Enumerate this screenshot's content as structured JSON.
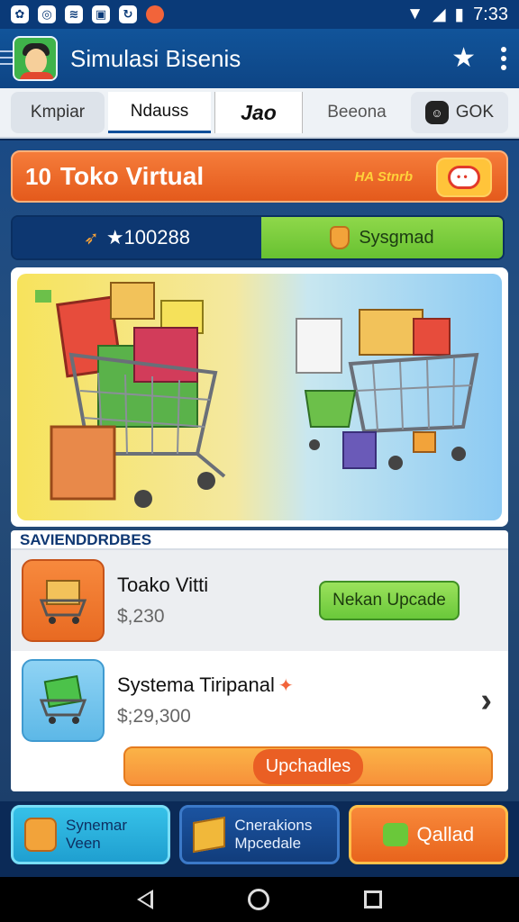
{
  "status_bar": {
    "icons": [
      "app-notification-icon",
      "messenger-icon",
      "notes-icon",
      "image-icon",
      "refresh-icon",
      "tomato-icon"
    ],
    "time": "7:33"
  },
  "app_bar": {
    "title": "Simulasi Bisenis"
  },
  "tabs": [
    {
      "label": "Kmpiar"
    },
    {
      "label": "Ndauss"
    },
    {
      "label": "Jao"
    },
    {
      "label": "Beeona"
    },
    {
      "label": "GOK"
    }
  ],
  "store": {
    "count": "10",
    "name": "Toko Virtual",
    "status": "HA Stnrb"
  },
  "stats": {
    "money": "★100288",
    "system": "Sysgmad"
  },
  "section": {
    "title": "SAVIENDDRDBES"
  },
  "items": [
    {
      "name": "Toako Vitti",
      "price": "$,230",
      "button": "Nekan Upcade"
    },
    {
      "name": "Systema Tiripanal",
      "price": "$;29,300"
    }
  ],
  "progress_button": "Upchadles",
  "actions": [
    {
      "label_line1": "Synemar",
      "label_line2": "Veen"
    },
    {
      "label_line1": "Cnerakions",
      "label_line2": "Mpcedale"
    },
    {
      "label": "Qallad"
    }
  ]
}
